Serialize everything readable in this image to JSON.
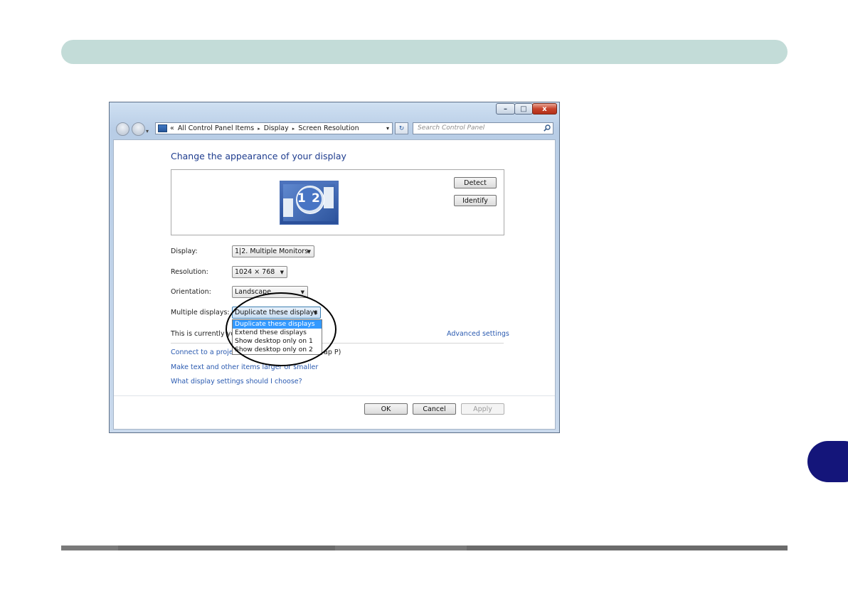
{
  "breadcrumb": {
    "prefix": "«",
    "items": [
      "All Control Panel Items",
      "Display",
      "Screen Resolution"
    ],
    "separator": "▸"
  },
  "search": {
    "placeholder": "Search Control Panel"
  },
  "window_buttons": {
    "minimize": "–",
    "maximize": "□",
    "close": "x"
  },
  "main": {
    "title": "Change the appearance of your display",
    "preview": {
      "monitor_label_1": "1",
      "monitor_label_2": "2"
    },
    "detect_label": "Detect",
    "identify_label": "Identify"
  },
  "settings": {
    "display": {
      "label": "Display:",
      "value": "1|2. Multiple Monitors"
    },
    "resolution": {
      "label": "Resolution:",
      "value": "1024 × 768"
    },
    "orientation": {
      "label": "Orientation:",
      "value": "Landscape"
    },
    "multiple_displays": {
      "label": "Multiple displays:",
      "value": "Duplicate these displays",
      "options": [
        "Duplicate these displays",
        "Extend these displays",
        "Show desktop only on 1",
        "Show desktop only on 2"
      ],
      "selected_index": 0
    },
    "status_text": "This is currently you",
    "advanced_link": "Advanced settings"
  },
  "links": {
    "connect_projector": "Connect to a proje",
    "connect_projector_tail": "ap P)",
    "text_size": "Make text and other items larger or smaller",
    "help": "What display settings should I choose?"
  },
  "footer_buttons": {
    "ok": "OK",
    "cancel": "Cancel",
    "apply": "Apply"
  },
  "colors": {
    "header_bar": "#c3dcd8",
    "page_tab": "#14157a",
    "link": "#2a5ab0",
    "title": "#1e3c8e",
    "selection": "#3399ff"
  }
}
